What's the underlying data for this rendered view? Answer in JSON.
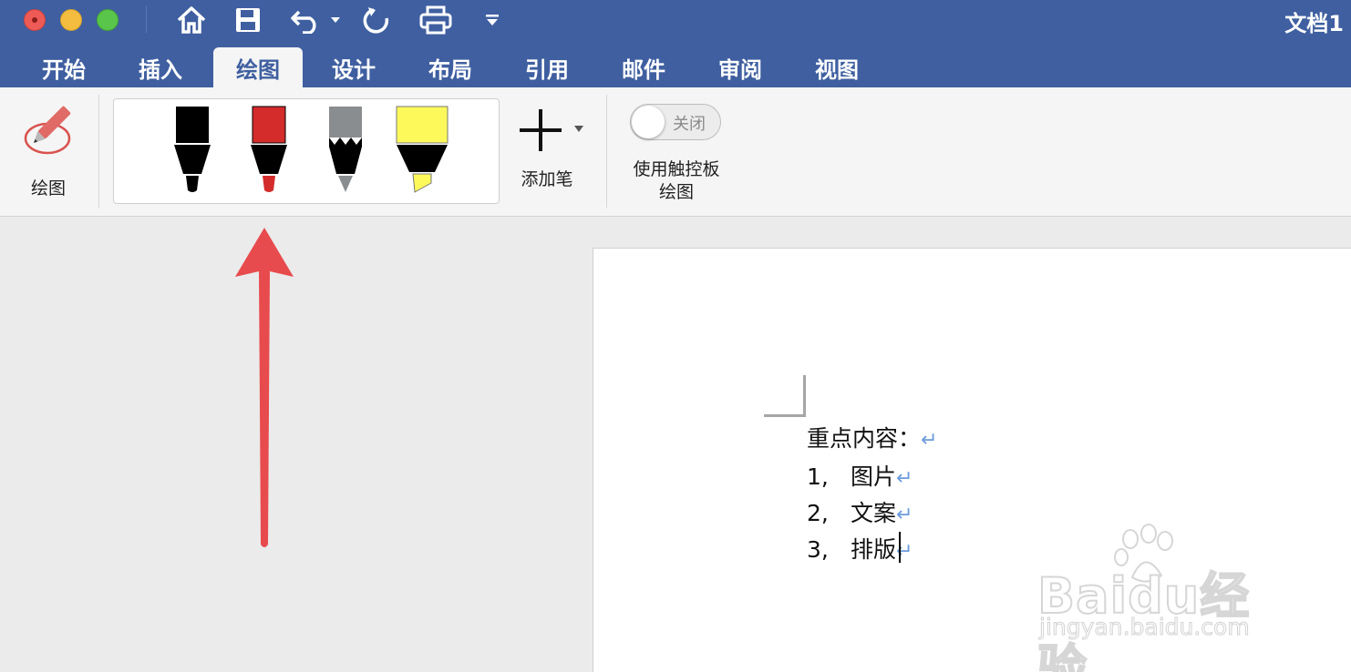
{
  "window": {
    "title": "文档1"
  },
  "quick_access": {
    "icons": [
      "home-icon",
      "save-icon",
      "undo-icon",
      "undo-dropdown-icon",
      "redo-icon",
      "print-icon",
      "customize-toolbar-icon"
    ]
  },
  "tabs": [
    {
      "label": "开始",
      "active": false
    },
    {
      "label": "插入",
      "active": false
    },
    {
      "label": "绘图",
      "active": true
    },
    {
      "label": "设计",
      "active": false
    },
    {
      "label": "布局",
      "active": false
    },
    {
      "label": "引用",
      "active": false
    },
    {
      "label": "邮件",
      "active": false
    },
    {
      "label": "审阅",
      "active": false
    },
    {
      "label": "视图",
      "active": false
    }
  ],
  "ribbon": {
    "draw_label": "绘图",
    "pens": [
      {
        "name": "black-pen",
        "color": "#000000"
      },
      {
        "name": "red-pen",
        "color": "#d42b2b"
      },
      {
        "name": "pencil",
        "color": "#8a8d90"
      },
      {
        "name": "highlighter",
        "color": "#fdf95b"
      }
    ],
    "add_pen_label": "添加笔",
    "toggle_state": "关闭",
    "trackpad_label_line1": "使用触控板",
    "trackpad_label_line2": "绘图"
  },
  "document": {
    "lines": [
      {
        "number": "",
        "text": "重点内容：",
        "mark": "↵"
      },
      {
        "number": "1,",
        "text": "图片",
        "mark": "↵"
      },
      {
        "number": "2,",
        "text": "文案",
        "mark": "↵"
      },
      {
        "number": "3,",
        "text": "排版",
        "mark": "↵"
      }
    ]
  },
  "watermark": {
    "brand": "Baidu经验",
    "url": "jingyan.baidu.com"
  },
  "colors": {
    "titlebar": "#3f5fa0",
    "ribbon": "#f5f5f5",
    "arrow": "#e84b4d",
    "pilcrow": "#6c9bdc"
  }
}
